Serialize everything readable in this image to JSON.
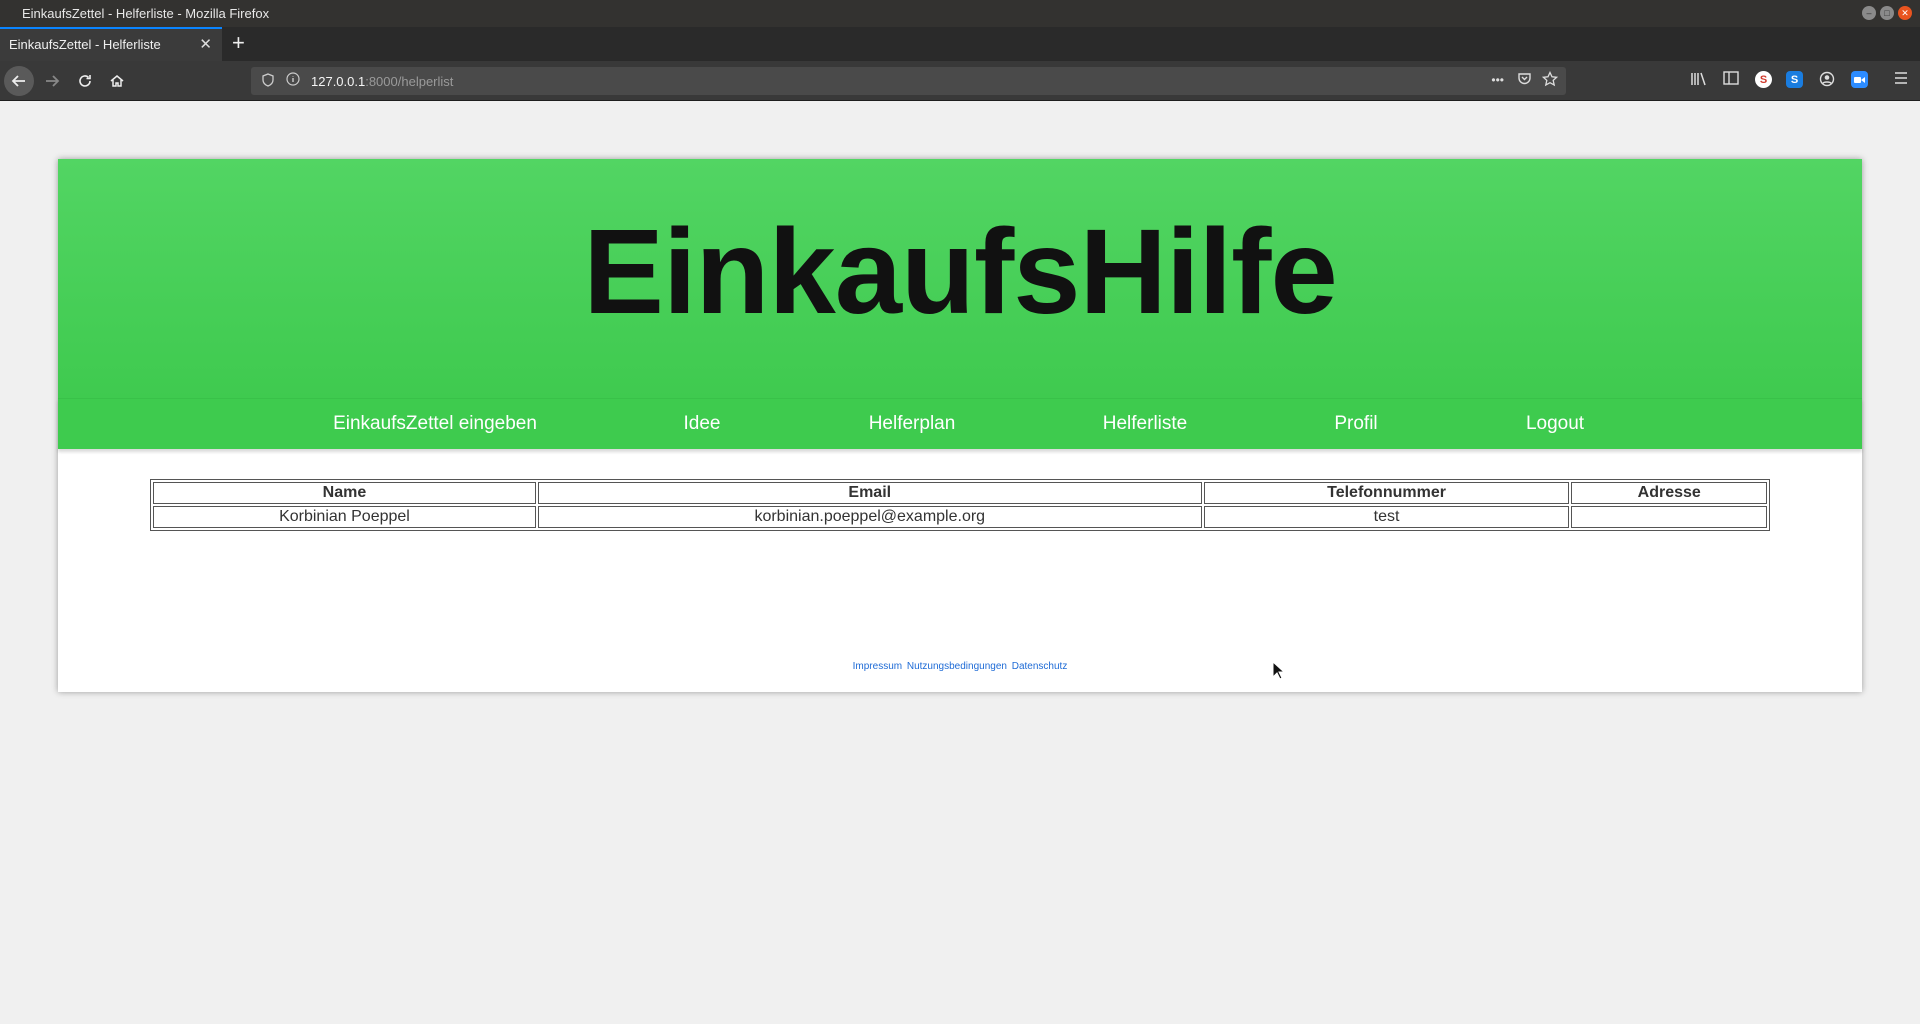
{
  "window": {
    "title": "EinkaufsZettel - Helferliste - Mozilla Firefox"
  },
  "tab": {
    "label": "EinkaufsZettel - Helferliste",
    "close": "✕",
    "new_tab": "+"
  },
  "urlbar": {
    "host": "127.0.0.1",
    "path": ":8000/helperlist",
    "more": "•••"
  },
  "site": {
    "title": "EinkaufsHilfe"
  },
  "menu": [
    {
      "label": "EinkaufsZettel eingeben"
    },
    {
      "label": "Idee"
    },
    {
      "label": "Helferplan"
    },
    {
      "label": "Helferliste"
    },
    {
      "label": "Profil"
    },
    {
      "label": "Logout"
    }
  ],
  "table": {
    "headers": [
      "Name",
      "Email",
      "Telefonnummer",
      "Adresse"
    ],
    "rows": [
      [
        "Korbinian Poeppel",
        "korbinian.poeppel@example.org",
        "test",
        ""
      ]
    ]
  },
  "footer": {
    "links": [
      "Impressum",
      "Nutzungsbedingungen",
      "Datenschutz"
    ]
  },
  "icons": {
    "back": "back-arrow-icon",
    "forward": "forward-arrow-icon",
    "reload": "reload-icon",
    "home": "home-icon",
    "library": "library-icon",
    "sidebar": "sidebar-icon",
    "account": "account-icon",
    "menu": "hamburger-menu-icon"
  },
  "colors": {
    "header_green": "#52d563",
    "menu_green": "#3ecb4e",
    "link_blue": "#1e6bd6",
    "page_bg": "#f0f0f0"
  }
}
